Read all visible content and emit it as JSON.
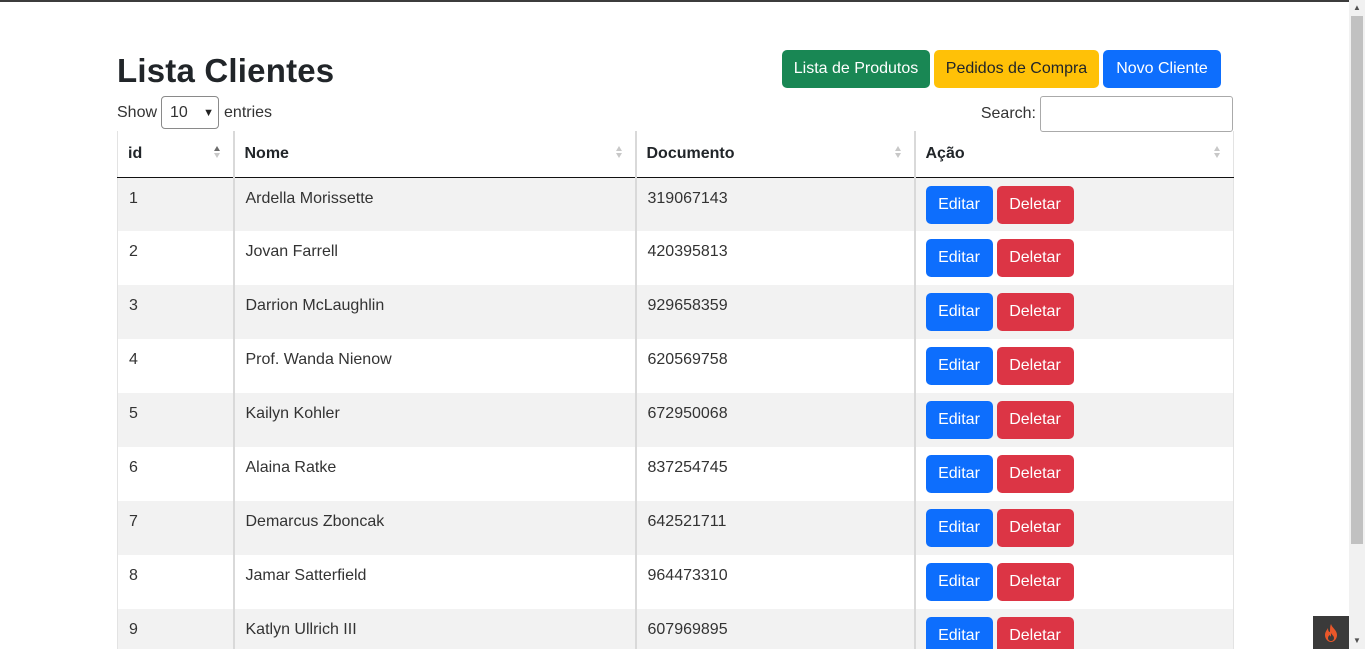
{
  "page": {
    "title": "Lista Clientes",
    "buttons": {
      "produtos": "Lista de Produtos",
      "pedidos": "Pedidos de Compra",
      "novo_cliente": "Novo Cliente"
    }
  },
  "length_control": {
    "prefix": "Show",
    "selected": "10",
    "suffix": "entries"
  },
  "search": {
    "label": "Search:",
    "value": ""
  },
  "table": {
    "columns": [
      "id",
      "Nome",
      "Documento",
      "Ação"
    ],
    "sorted_column": "id",
    "sort_direction": "asc",
    "action_labels": {
      "edit": "Editar",
      "delete": "Deletar"
    },
    "rows": [
      {
        "id": "1",
        "nome": "Ardella Morissette",
        "documento": "319067143"
      },
      {
        "id": "2",
        "nome": "Jovan Farrell",
        "documento": "420395813"
      },
      {
        "id": "3",
        "nome": "Darrion McLaughlin",
        "documento": "929658359"
      },
      {
        "id": "4",
        "nome": "Prof. Wanda Nienow",
        "documento": "620569758"
      },
      {
        "id": "5",
        "nome": "Kailyn Kohler",
        "documento": "672950068"
      },
      {
        "id": "6",
        "nome": "Alaina Ratke",
        "documento": "837254745"
      },
      {
        "id": "7",
        "nome": "Demarcus Zboncak",
        "documento": "642521711"
      },
      {
        "id": "8",
        "nome": "Jamar Satterfield",
        "documento": "964473310"
      },
      {
        "id": "9",
        "nome": "Katlyn Ullrich III",
        "documento": "607969895"
      }
    ]
  },
  "colors": {
    "success": "#198754",
    "warning": "#ffc107",
    "primary": "#0d6efd",
    "danger": "#dc3545",
    "striped_row": "#f2f2f2"
  },
  "icons": {
    "sort": "sort-arrows-icon",
    "badge": "flame-icon",
    "select": "chevron-down-icon"
  }
}
